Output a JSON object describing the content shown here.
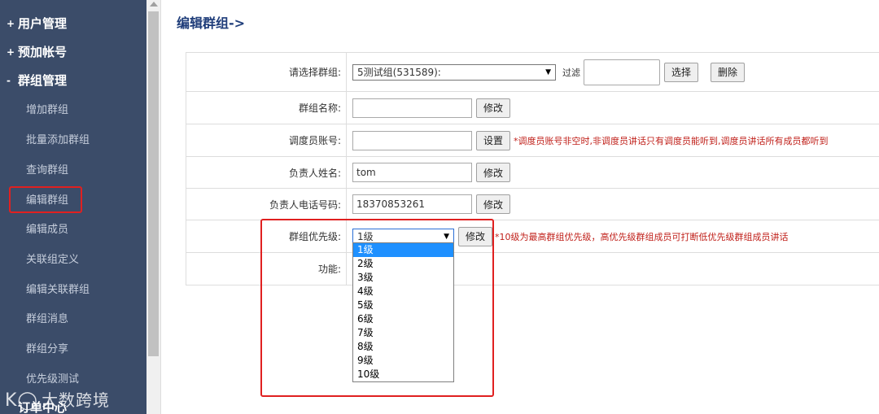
{
  "sidebar": {
    "sections": [
      {
        "sign": "+",
        "title": "用户管理"
      },
      {
        "sign": "+",
        "title": "预加帐号"
      },
      {
        "sign": "-",
        "title": "群组管理"
      }
    ],
    "items": [
      "增加群组",
      "批量添加群组",
      "查询群组",
      "编辑群组",
      "编辑成员",
      "关联组定义",
      "编辑关联群组",
      "群组消息",
      "群组分享",
      "优先级测试"
    ],
    "partial_section": "订单中心",
    "active_item": "编辑群组",
    "watermark": "大数跨境",
    "watermark_logo": "K◯"
  },
  "page": {
    "title": "编辑群组->"
  },
  "form": {
    "group_select": {
      "label": "请选择群组:",
      "value": "5测试组(531589):",
      "filter_label": "过滤",
      "filter_value": "",
      "choose_button": "选择",
      "delete_button": "删除"
    },
    "group_name": {
      "label": "群组名称:",
      "value": "",
      "button": "修改"
    },
    "dispatcher": {
      "label": "调度员账号:",
      "value": "",
      "button": "设置",
      "note": "*调度员账号非空时,非调度员讲话只有调度员能听到,调度员讲话所有成员都听到"
    },
    "owner_name": {
      "label": "负责人姓名:",
      "value": "tom",
      "button": "修改"
    },
    "owner_phone": {
      "label": "负责人电话号码:",
      "value": "18370853261",
      "button": "修改"
    },
    "priority": {
      "label": "群组优先级:",
      "value": "1级",
      "button": "修改",
      "note": "*10级为最高群组优先级，高优先级群组成员可打断低优先级群组成员讲话",
      "options": [
        "1级",
        "2级",
        "3级",
        "4级",
        "5级",
        "6级",
        "7级",
        "8级",
        "9级",
        "10级"
      ]
    },
    "function": {
      "label": "功能:"
    }
  }
}
